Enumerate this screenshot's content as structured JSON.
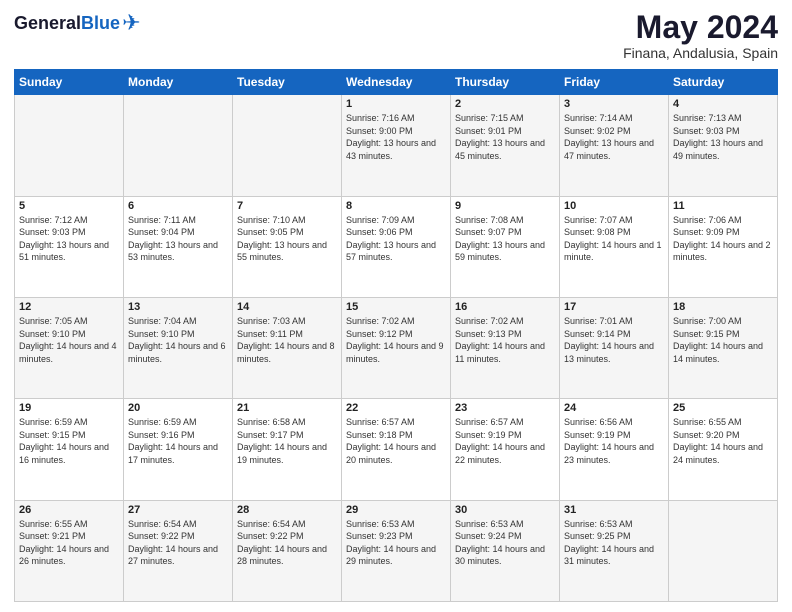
{
  "header": {
    "title": "May 2024",
    "subtitle": "Finana, Andalusia, Spain"
  },
  "columns": [
    "Sunday",
    "Monday",
    "Tuesday",
    "Wednesday",
    "Thursday",
    "Friday",
    "Saturday"
  ],
  "weeks": [
    [
      {
        "day": "",
        "info": ""
      },
      {
        "day": "",
        "info": ""
      },
      {
        "day": "",
        "info": ""
      },
      {
        "day": "1",
        "info": "Sunrise: 7:16 AM\nSunset: 9:00 PM\nDaylight: 13 hours\nand 43 minutes."
      },
      {
        "day": "2",
        "info": "Sunrise: 7:15 AM\nSunset: 9:01 PM\nDaylight: 13 hours\nand 45 minutes."
      },
      {
        "day": "3",
        "info": "Sunrise: 7:14 AM\nSunset: 9:02 PM\nDaylight: 13 hours\nand 47 minutes."
      },
      {
        "day": "4",
        "info": "Sunrise: 7:13 AM\nSunset: 9:03 PM\nDaylight: 13 hours\nand 49 minutes."
      }
    ],
    [
      {
        "day": "5",
        "info": "Sunrise: 7:12 AM\nSunset: 9:03 PM\nDaylight: 13 hours\nand 51 minutes."
      },
      {
        "day": "6",
        "info": "Sunrise: 7:11 AM\nSunset: 9:04 PM\nDaylight: 13 hours\nand 53 minutes."
      },
      {
        "day": "7",
        "info": "Sunrise: 7:10 AM\nSunset: 9:05 PM\nDaylight: 13 hours\nand 55 minutes."
      },
      {
        "day": "8",
        "info": "Sunrise: 7:09 AM\nSunset: 9:06 PM\nDaylight: 13 hours\nand 57 minutes."
      },
      {
        "day": "9",
        "info": "Sunrise: 7:08 AM\nSunset: 9:07 PM\nDaylight: 13 hours\nand 59 minutes."
      },
      {
        "day": "10",
        "info": "Sunrise: 7:07 AM\nSunset: 9:08 PM\nDaylight: 14 hours\nand 1 minute."
      },
      {
        "day": "11",
        "info": "Sunrise: 7:06 AM\nSunset: 9:09 PM\nDaylight: 14 hours\nand 2 minutes."
      }
    ],
    [
      {
        "day": "12",
        "info": "Sunrise: 7:05 AM\nSunset: 9:10 PM\nDaylight: 14 hours\nand 4 minutes."
      },
      {
        "day": "13",
        "info": "Sunrise: 7:04 AM\nSunset: 9:10 PM\nDaylight: 14 hours\nand 6 minutes."
      },
      {
        "day": "14",
        "info": "Sunrise: 7:03 AM\nSunset: 9:11 PM\nDaylight: 14 hours\nand 8 minutes."
      },
      {
        "day": "15",
        "info": "Sunrise: 7:02 AM\nSunset: 9:12 PM\nDaylight: 14 hours\nand 9 minutes."
      },
      {
        "day": "16",
        "info": "Sunrise: 7:02 AM\nSunset: 9:13 PM\nDaylight: 14 hours\nand 11 minutes."
      },
      {
        "day": "17",
        "info": "Sunrise: 7:01 AM\nSunset: 9:14 PM\nDaylight: 14 hours\nand 13 minutes."
      },
      {
        "day": "18",
        "info": "Sunrise: 7:00 AM\nSunset: 9:15 PM\nDaylight: 14 hours\nand 14 minutes."
      }
    ],
    [
      {
        "day": "19",
        "info": "Sunrise: 6:59 AM\nSunset: 9:15 PM\nDaylight: 14 hours\nand 16 minutes."
      },
      {
        "day": "20",
        "info": "Sunrise: 6:59 AM\nSunset: 9:16 PM\nDaylight: 14 hours\nand 17 minutes."
      },
      {
        "day": "21",
        "info": "Sunrise: 6:58 AM\nSunset: 9:17 PM\nDaylight: 14 hours\nand 19 minutes."
      },
      {
        "day": "22",
        "info": "Sunrise: 6:57 AM\nSunset: 9:18 PM\nDaylight: 14 hours\nand 20 minutes."
      },
      {
        "day": "23",
        "info": "Sunrise: 6:57 AM\nSunset: 9:19 PM\nDaylight: 14 hours\nand 22 minutes."
      },
      {
        "day": "24",
        "info": "Sunrise: 6:56 AM\nSunset: 9:19 PM\nDaylight: 14 hours\nand 23 minutes."
      },
      {
        "day": "25",
        "info": "Sunrise: 6:55 AM\nSunset: 9:20 PM\nDaylight: 14 hours\nand 24 minutes."
      }
    ],
    [
      {
        "day": "26",
        "info": "Sunrise: 6:55 AM\nSunset: 9:21 PM\nDaylight: 14 hours\nand 26 minutes."
      },
      {
        "day": "27",
        "info": "Sunrise: 6:54 AM\nSunset: 9:22 PM\nDaylight: 14 hours\nand 27 minutes."
      },
      {
        "day": "28",
        "info": "Sunrise: 6:54 AM\nSunset: 9:22 PM\nDaylight: 14 hours\nand 28 minutes."
      },
      {
        "day": "29",
        "info": "Sunrise: 6:53 AM\nSunset: 9:23 PM\nDaylight: 14 hours\nand 29 minutes."
      },
      {
        "day": "30",
        "info": "Sunrise: 6:53 AM\nSunset: 9:24 PM\nDaylight: 14 hours\nand 30 minutes."
      },
      {
        "day": "31",
        "info": "Sunrise: 6:53 AM\nSunset: 9:25 PM\nDaylight: 14 hours\nand 31 minutes."
      },
      {
        "day": "",
        "info": ""
      }
    ]
  ]
}
